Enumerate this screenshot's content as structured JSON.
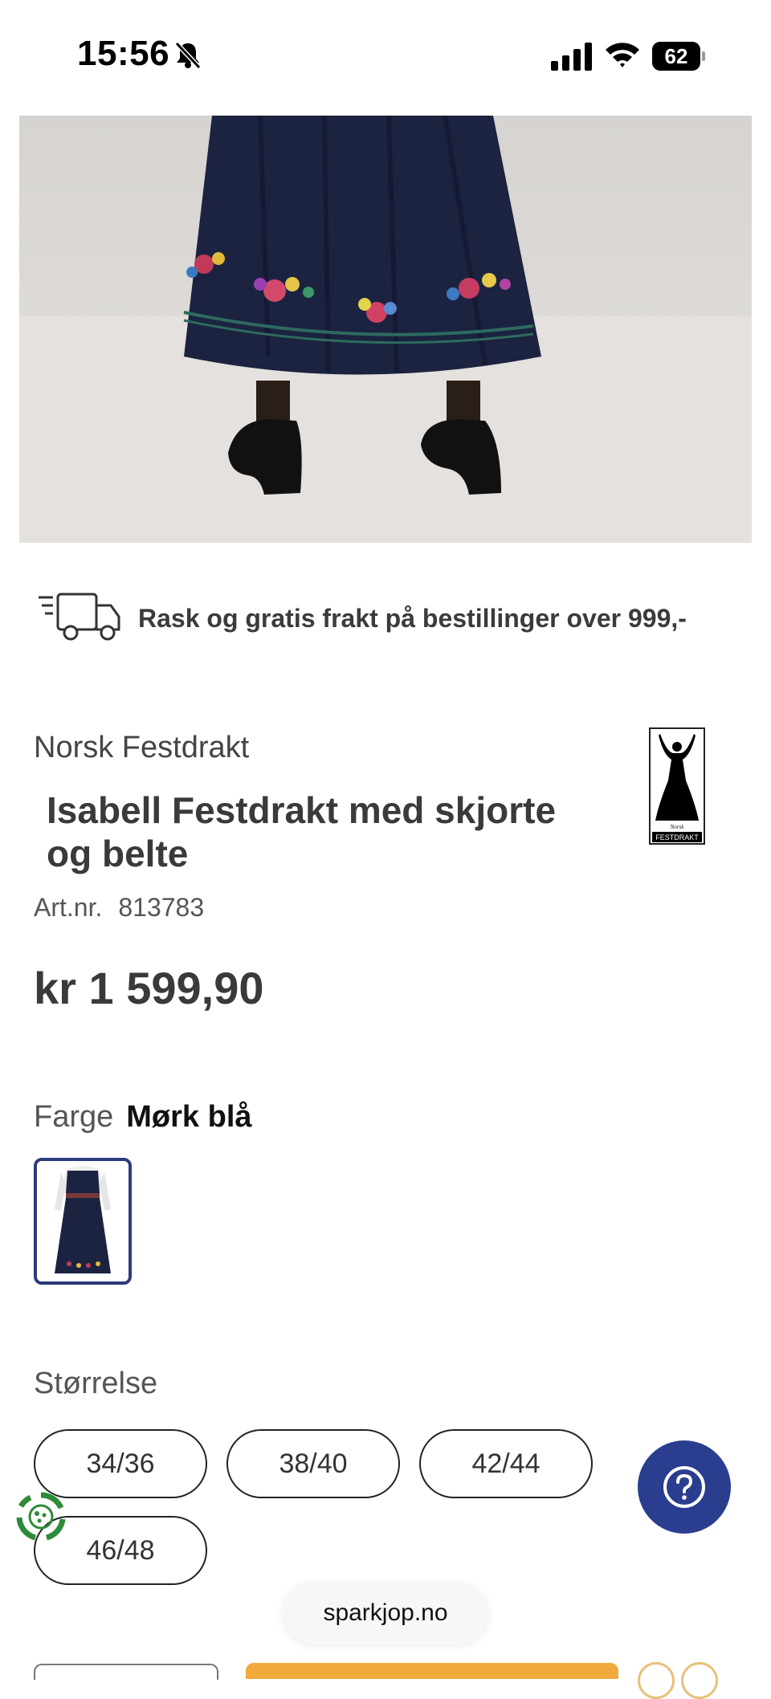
{
  "status_bar": {
    "time": "15:56",
    "battery": "62",
    "battery_level": 0.62
  },
  "shipping": {
    "text": "Rask og gratis frakt på bestillinger over 999,-"
  },
  "product": {
    "brand": "Norsk Festdrakt",
    "title": "Isabell Festdrakt med skjorte og belte",
    "artnr_label": "Art.nr.",
    "artnr_value": "813783",
    "price": "kr 1 599,90",
    "logo_text": "FESTDRAKT",
    "logo_script": "Norsk"
  },
  "color": {
    "label": "Farge",
    "value": "Mørk blå"
  },
  "size": {
    "label": "Størrelse",
    "options": [
      "34/36",
      "38/40",
      "42/44",
      "46/48"
    ]
  },
  "footer": {
    "domain": "sparkjop.no"
  },
  "colors": {
    "accent": "#2a3d8f",
    "cta": "#f2a93b",
    "skirt": "#1b2340"
  },
  "icons": [
    "bell-slash-icon",
    "signal-icon",
    "wifi-icon",
    "battery-icon",
    "truck-icon",
    "help-icon",
    "eco-icon"
  ]
}
